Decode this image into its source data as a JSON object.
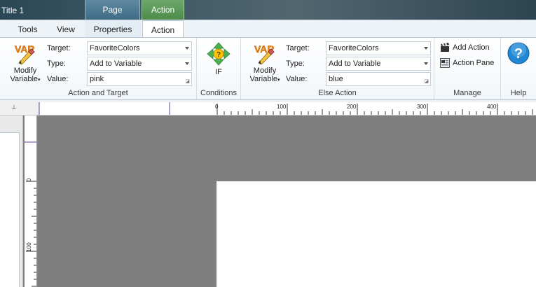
{
  "window": {
    "title": "Title 1"
  },
  "context_tabs": {
    "page": "Page",
    "action": "Action"
  },
  "tabs": [
    {
      "label": "Tools"
    },
    {
      "label": "View"
    },
    {
      "label": "Properties"
    },
    {
      "label": "Action"
    }
  ],
  "ribbon": {
    "action_target": {
      "label": "Action and Target",
      "modify_variable": {
        "line1": "Modify",
        "line2": "Variable"
      },
      "target_label": "Target:",
      "target_value": "FavoriteColors",
      "type_label": "Type:",
      "type_value": "Add to Variable",
      "value_label": "Value:",
      "value_value": "pink"
    },
    "conditions": {
      "label": "Conditions",
      "if_label": "IF"
    },
    "else_action": {
      "label": "Else Action",
      "modify_variable": {
        "line1": "Modify",
        "line2": "Variable"
      },
      "target_label": "Target:",
      "target_value": "FavoriteColors",
      "type_label": "Type:",
      "type_value": "Add to Variable",
      "value_label": "Value:",
      "value_value": "blue"
    },
    "manage": {
      "label": "Manage",
      "add_action": "Add Action",
      "action_pane": "Action Pane"
    },
    "help": {
      "label": "Help"
    }
  },
  "rulers": {
    "horizontal": [
      "0",
      "100",
      "200",
      "300",
      "400"
    ],
    "vertical": [
      "0",
      "100"
    ]
  },
  "colors": {
    "accent_page": "#4f7d96",
    "accent_action": "#5e9a5b",
    "canvas": "#7f7f7f",
    "help_blue": "#1e88d6",
    "var_orange": "#f08a1c"
  }
}
